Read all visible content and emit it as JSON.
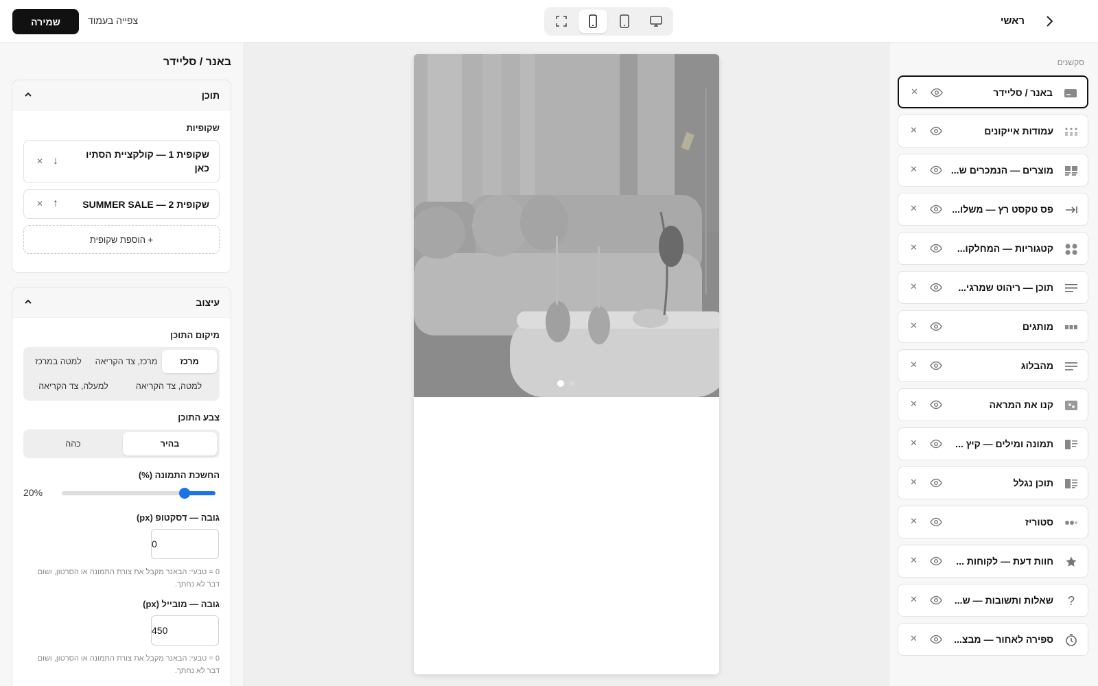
{
  "topbar": {
    "save_label": "שמירה",
    "view_page_label": "צפייה בעמוד",
    "home_label": "ראשי"
  },
  "left": {
    "panel_title": "באנר / סליידר",
    "content_card": {
      "title": "תוכן",
      "slides_label": "שקופיות",
      "slides": [
        {
          "line1": "שקופית 1 — קולקציית הסתיו",
          "line2": "כאן"
        },
        {
          "line1": "שקופית 2 — SUMMER SALE",
          "line2": ""
        }
      ],
      "add_slide_label": "+ הוספת שקופית"
    },
    "design_card": {
      "title": "עיצוב",
      "position_label": "מיקום התוכן",
      "position_options": [
        "מרכז",
        "מרכז, צד הקריאה",
        "למטה במרכז",
        "למטה, צד הקריאה",
        "למעלה, צד הקריאה"
      ],
      "position_selected": "מרכז",
      "color_label": "צבע התוכן",
      "color_options": [
        "בהיר",
        "כהה"
      ],
      "color_selected": "בהיר",
      "darken_label": "החשכת התמונה (%)",
      "darken_value_text": "20%",
      "darken_value": 20,
      "desktop_height_label": "גובה — דסקטופ (px)",
      "desktop_height_value": "0",
      "desktop_hint": "0 = טבעי: הבאנר מקבל את צורת התמונה או הסרטון, ושום דבר לא נחתך.",
      "mobile_height_label": "גובה — מובייל (px)",
      "mobile_height_value": "450",
      "mobile_hint": "0 = טבעי: הבאנר מקבל את צורת התמונה או הסרטון, ושום דבר לא נחתך."
    }
  },
  "right": {
    "sections_label": "סקשנים",
    "sections": [
      {
        "label": "באנר / סליידר",
        "icon": "banner-icon",
        "active": true
      },
      {
        "label": "עמודות אייקונים",
        "icon": "icon-grid-icon",
        "active": false
      },
      {
        "label": "מוצרים — הנמכרים ש...",
        "icon": "products-icon",
        "active": false
      },
      {
        "label": "פס טקסט רץ — משלו...",
        "icon": "marquee-icon",
        "active": false
      },
      {
        "label": "קטגוריות — המחלקו...",
        "icon": "categories-icon",
        "active": false
      },
      {
        "label": "תוכן — ריהוט שמרגי...",
        "icon": "text-icon",
        "active": false
      },
      {
        "label": "מותגים",
        "icon": "brands-icon",
        "active": false
      },
      {
        "label": "מהבלוג",
        "icon": "blog-icon",
        "active": false
      },
      {
        "label": "קנו את המראה",
        "icon": "shop-look-icon",
        "active": false
      },
      {
        "label": "תמונה ומילים — קיץ ...",
        "icon": "image-text-icon",
        "active": false
      },
      {
        "label": "תוכן נגלל",
        "icon": "scroll-content-icon",
        "active": false
      },
      {
        "label": "סטוריז",
        "icon": "stories-icon",
        "active": false
      },
      {
        "label": "חוות דעת — לקוחות ...",
        "icon": "star-icon",
        "active": false
      },
      {
        "label": "שאלות ותשובות — ש...",
        "icon": "question-icon",
        "active": false
      },
      {
        "label": "ספירה לאחור — מבצ...",
        "icon": "timer-icon",
        "active": false
      }
    ]
  },
  "colors": {
    "accent": "#1a73e8",
    "primary": "#111111"
  }
}
